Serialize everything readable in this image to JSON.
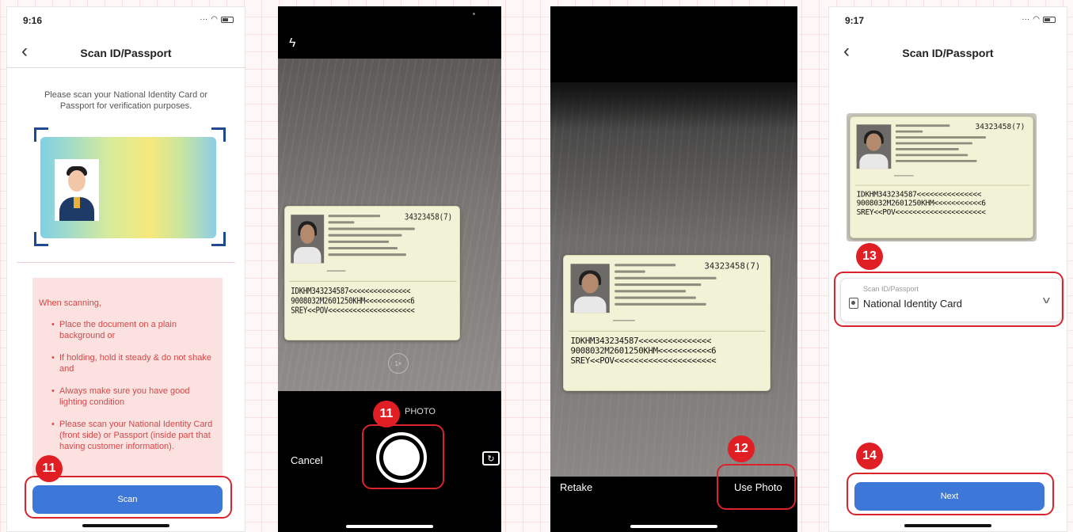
{
  "screen1": {
    "time": "9:16",
    "title": "Scan ID/Passport",
    "intro": "Please scan your National Identity Card or Passport for verification purposes.",
    "instructions_heading": "When scanning,",
    "instructions": [
      "Place the document on a plain background or",
      "If holding, hold it steady & do not shake and",
      "Always make sure you have good lighting condition",
      "Please scan your National Identity Card (front side) or Passport (inside part that having customer information)."
    ],
    "scan_label": "Scan",
    "step_badge": "11"
  },
  "screen2": {
    "zoom_label": "1×",
    "mode_label": "PHOTO",
    "cancel_label": "Cancel",
    "step_badge": "11"
  },
  "screen3": {
    "retake_label": "Retake",
    "use_photo_label": "Use Photo",
    "step_badge": "12"
  },
  "screen4": {
    "time": "9:17",
    "title": "Scan ID/Passport",
    "select_label": "Scan ID/Passport",
    "select_value": "National Identity Card",
    "next_label": "Next",
    "step_badge_select": "13",
    "step_badge_next": "14"
  },
  "id_card": {
    "number": "34323458(7)",
    "mrz": [
      "IDKHM343234587<<<<<<<<<<<<<<<",
      "9008032M2601250KHM<<<<<<<<<<<6",
      "SREY<<POV<<<<<<<<<<<<<<<<<<<<<"
    ]
  },
  "colors": {
    "primary_button": "#3d78d9",
    "highlight": "#d9232d",
    "badge": "#e01f25",
    "instruction_bg": "#fbe2e0",
    "instruction_text": "#d64646"
  },
  "icons": [
    "back-icon",
    "flash-icon",
    "flip-camera-icon",
    "shutter-button",
    "id-card-icon",
    "chevron-down-icon"
  ]
}
